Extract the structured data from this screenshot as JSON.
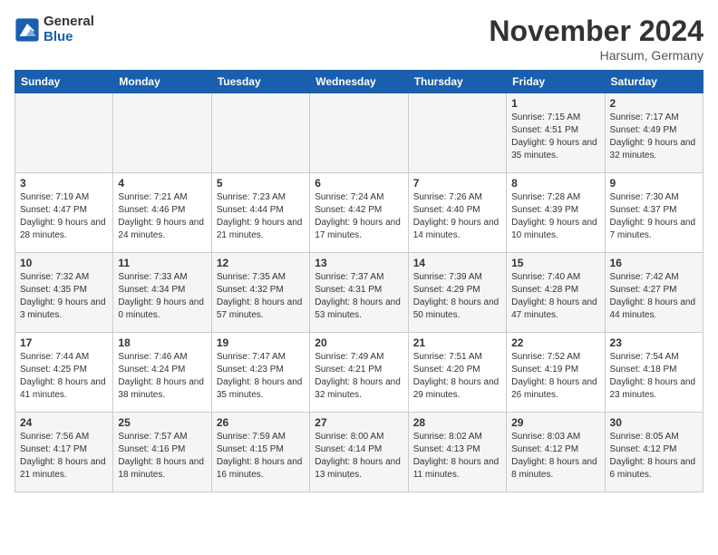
{
  "logo": {
    "general": "General",
    "blue": "Blue"
  },
  "title": "November 2024",
  "location": "Harsum, Germany",
  "days_of_week": [
    "Sunday",
    "Monday",
    "Tuesday",
    "Wednesday",
    "Thursday",
    "Friday",
    "Saturday"
  ],
  "weeks": [
    [
      {
        "day": "",
        "info": ""
      },
      {
        "day": "",
        "info": ""
      },
      {
        "day": "",
        "info": ""
      },
      {
        "day": "",
        "info": ""
      },
      {
        "day": "",
        "info": ""
      },
      {
        "day": "1",
        "info": "Sunrise: 7:15 AM\nSunset: 4:51 PM\nDaylight: 9 hours and 35 minutes."
      },
      {
        "day": "2",
        "info": "Sunrise: 7:17 AM\nSunset: 4:49 PM\nDaylight: 9 hours and 32 minutes."
      }
    ],
    [
      {
        "day": "3",
        "info": "Sunrise: 7:19 AM\nSunset: 4:47 PM\nDaylight: 9 hours and 28 minutes."
      },
      {
        "day": "4",
        "info": "Sunrise: 7:21 AM\nSunset: 4:46 PM\nDaylight: 9 hours and 24 minutes."
      },
      {
        "day": "5",
        "info": "Sunrise: 7:23 AM\nSunset: 4:44 PM\nDaylight: 9 hours and 21 minutes."
      },
      {
        "day": "6",
        "info": "Sunrise: 7:24 AM\nSunset: 4:42 PM\nDaylight: 9 hours and 17 minutes."
      },
      {
        "day": "7",
        "info": "Sunrise: 7:26 AM\nSunset: 4:40 PM\nDaylight: 9 hours and 14 minutes."
      },
      {
        "day": "8",
        "info": "Sunrise: 7:28 AM\nSunset: 4:39 PM\nDaylight: 9 hours and 10 minutes."
      },
      {
        "day": "9",
        "info": "Sunrise: 7:30 AM\nSunset: 4:37 PM\nDaylight: 9 hours and 7 minutes."
      }
    ],
    [
      {
        "day": "10",
        "info": "Sunrise: 7:32 AM\nSunset: 4:35 PM\nDaylight: 9 hours and 3 minutes."
      },
      {
        "day": "11",
        "info": "Sunrise: 7:33 AM\nSunset: 4:34 PM\nDaylight: 9 hours and 0 minutes."
      },
      {
        "day": "12",
        "info": "Sunrise: 7:35 AM\nSunset: 4:32 PM\nDaylight: 8 hours and 57 minutes."
      },
      {
        "day": "13",
        "info": "Sunrise: 7:37 AM\nSunset: 4:31 PM\nDaylight: 8 hours and 53 minutes."
      },
      {
        "day": "14",
        "info": "Sunrise: 7:39 AM\nSunset: 4:29 PM\nDaylight: 8 hours and 50 minutes."
      },
      {
        "day": "15",
        "info": "Sunrise: 7:40 AM\nSunset: 4:28 PM\nDaylight: 8 hours and 47 minutes."
      },
      {
        "day": "16",
        "info": "Sunrise: 7:42 AM\nSunset: 4:27 PM\nDaylight: 8 hours and 44 minutes."
      }
    ],
    [
      {
        "day": "17",
        "info": "Sunrise: 7:44 AM\nSunset: 4:25 PM\nDaylight: 8 hours and 41 minutes."
      },
      {
        "day": "18",
        "info": "Sunrise: 7:46 AM\nSunset: 4:24 PM\nDaylight: 8 hours and 38 minutes."
      },
      {
        "day": "19",
        "info": "Sunrise: 7:47 AM\nSunset: 4:23 PM\nDaylight: 8 hours and 35 minutes."
      },
      {
        "day": "20",
        "info": "Sunrise: 7:49 AM\nSunset: 4:21 PM\nDaylight: 8 hours and 32 minutes."
      },
      {
        "day": "21",
        "info": "Sunrise: 7:51 AM\nSunset: 4:20 PM\nDaylight: 8 hours and 29 minutes."
      },
      {
        "day": "22",
        "info": "Sunrise: 7:52 AM\nSunset: 4:19 PM\nDaylight: 8 hours and 26 minutes."
      },
      {
        "day": "23",
        "info": "Sunrise: 7:54 AM\nSunset: 4:18 PM\nDaylight: 8 hours and 23 minutes."
      }
    ],
    [
      {
        "day": "24",
        "info": "Sunrise: 7:56 AM\nSunset: 4:17 PM\nDaylight: 8 hours and 21 minutes."
      },
      {
        "day": "25",
        "info": "Sunrise: 7:57 AM\nSunset: 4:16 PM\nDaylight: 8 hours and 18 minutes."
      },
      {
        "day": "26",
        "info": "Sunrise: 7:59 AM\nSunset: 4:15 PM\nDaylight: 8 hours and 16 minutes."
      },
      {
        "day": "27",
        "info": "Sunrise: 8:00 AM\nSunset: 4:14 PM\nDaylight: 8 hours and 13 minutes."
      },
      {
        "day": "28",
        "info": "Sunrise: 8:02 AM\nSunset: 4:13 PM\nDaylight: 8 hours and 11 minutes."
      },
      {
        "day": "29",
        "info": "Sunrise: 8:03 AM\nSunset: 4:12 PM\nDaylight: 8 hours and 8 minutes."
      },
      {
        "day": "30",
        "info": "Sunrise: 8:05 AM\nSunset: 4:12 PM\nDaylight: 8 hours and 6 minutes."
      }
    ]
  ]
}
